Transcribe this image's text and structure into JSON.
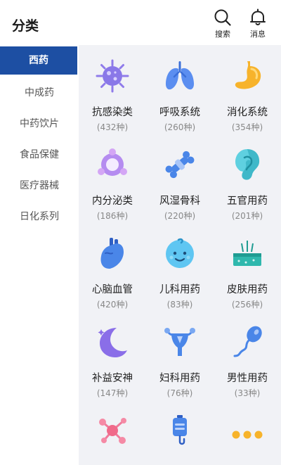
{
  "header": {
    "title": "分类",
    "search_label": "搜索",
    "message_label": "消息"
  },
  "sidebar": {
    "items": [
      {
        "label": "西药",
        "active": true
      },
      {
        "label": "中成药",
        "active": false
      },
      {
        "label": "中药饮片",
        "active": false
      },
      {
        "label": "食品保健",
        "active": false
      },
      {
        "label": "医疗器械",
        "active": false
      },
      {
        "label": "日化系列",
        "active": false
      }
    ]
  },
  "categories": [
    {
      "name": "抗感染类",
      "count": "(432种)",
      "icon": "virus-icon"
    },
    {
      "name": "呼吸系统",
      "count": "(260种)",
      "icon": "lungs-icon"
    },
    {
      "name": "消化系统",
      "count": "(354种)",
      "icon": "stomach-icon"
    },
    {
      "name": "内分泌类",
      "count": "(186种)",
      "icon": "endocrine-icon"
    },
    {
      "name": "风湿骨科",
      "count": "(220种)",
      "icon": "bone-joint-icon"
    },
    {
      "name": "五官用药",
      "count": "(201种)",
      "icon": "ear-icon"
    },
    {
      "name": "心脑血管",
      "count": "(420种)",
      "icon": "heart-icon"
    },
    {
      "name": "儿科用药",
      "count": "(83种)",
      "icon": "baby-face-icon"
    },
    {
      "name": "皮肤用药",
      "count": "(256种)",
      "icon": "skin-icon"
    },
    {
      "name": "补益安神",
      "count": "(147种)",
      "icon": "moon-icon"
    },
    {
      "name": "妇科用药",
      "count": "(76种)",
      "icon": "uterus-icon"
    },
    {
      "name": "男性用药",
      "count": "(33种)",
      "icon": "sperm-icon"
    },
    {
      "name": "",
      "count": "",
      "icon": "molecule-icon"
    },
    {
      "name": "",
      "count": "",
      "icon": "iv-drip-icon"
    },
    {
      "name": "",
      "count": "",
      "icon": "more-dots-icon"
    }
  ],
  "colors": {
    "accent": "#1d4fa3",
    "icon_blue": "#4a86e8",
    "icon_purple": "#9a6ee0",
    "icon_orange": "#f7b32b",
    "icon_pink": "#f06a8a"
  }
}
